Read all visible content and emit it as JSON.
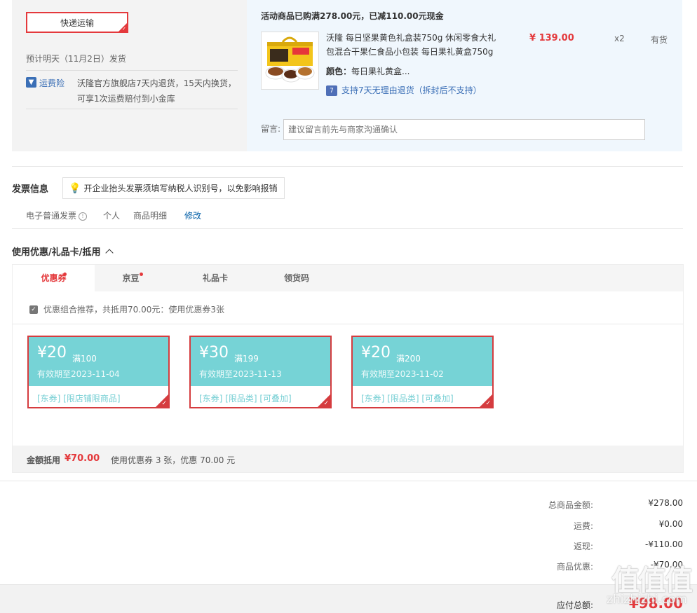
{
  "order": {
    "shipping_method": "快递运输",
    "ship_date": "预计明天（11月2日）发货",
    "insurance_label": "运费险",
    "insurance_desc": "沃隆官方旗舰店7天内退货，15天内换货，可享1次运费赔付到小金库",
    "promo": "活动商品已购满278.00元，已减110.00元现金",
    "product_name": "沃隆 每日坚果黄色礼盒装750g 休闲零食大礼包混合干果仁食品小包装 每日果礼黄盒750g",
    "price": "¥ 139.00",
    "qty": "x2",
    "stock": "有货",
    "color_label": "颜色：",
    "color_value": "每日果礼黄盒...",
    "return_policy": "支持7天无理由退货（拆封后不支持）",
    "remark_label": "留言:",
    "remark_placeholder": "建议留言前先与商家沟通确认"
  },
  "invoice": {
    "title": "发票信息",
    "tip": "开企业抬头发票须填写纳税人识别号，以免影响报销",
    "type": "电子普通发票",
    "info_glyph": "!",
    "person": "个人",
    "detail": "商品明细",
    "edit": "修改"
  },
  "coupons": {
    "title": "使用优惠/礼品卡/抵用",
    "tabs": [
      "优惠券",
      "京豆",
      "礼品卡",
      "领货码"
    ],
    "combo": "优惠组合推荐，共抵用70.00元：使用优惠券3张",
    "items": [
      {
        "amount": "¥20",
        "cond": "满100",
        "expiry": "有效期至2023-11-04",
        "tags": "[东券]  [限店铺限商品]"
      },
      {
        "amount": "¥30",
        "cond": "满199",
        "expiry": "有效期至2023-11-13",
        "tags": "[东券]  [限品类]  [可叠加]"
      },
      {
        "amount": "¥20",
        "cond": "满200",
        "expiry": "有效期至2023-11-02",
        "tags": "[东券]  [限品类]  [可叠加]"
      }
    ],
    "summary_label": "金额抵用",
    "summary_amount": "¥70.00",
    "summary_desc": "使用优惠券 3 张，优惠 70.00 元"
  },
  "totals": {
    "goods_label": "总商品金额:",
    "goods_value": "¥278.00",
    "freight_label": "运费:",
    "freight_value": "¥0.00",
    "rebate_label": "返现:",
    "rebate_value": "-¥110.00",
    "discount_label": "商品优惠:",
    "discount_value": "-¥70.00",
    "due_label": "应付总额:",
    "due_value": "¥98.00"
  },
  "watermark": {
    "text": "值值值",
    "url": "zhizhizhi.com"
  },
  "colors": {
    "accent": "#e4393c",
    "coupon": "#76d3d6",
    "link": "#005ea7"
  }
}
